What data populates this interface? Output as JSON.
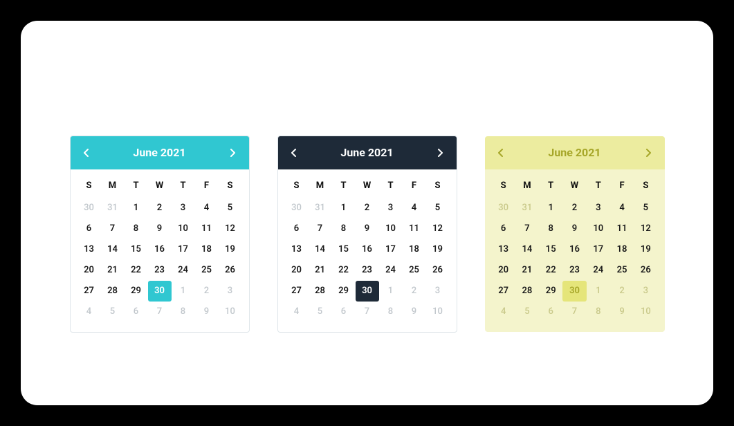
{
  "calendars": [
    {
      "theme": "teal",
      "title": "June 2021"
    },
    {
      "theme": "dark",
      "title": "June 2021"
    },
    {
      "theme": "olive",
      "title": "June 2021"
    }
  ],
  "dow": [
    "S",
    "M",
    "T",
    "W",
    "T",
    "F",
    "S"
  ],
  "grid": [
    [
      {
        "d": 30,
        "muted": true
      },
      {
        "d": 31,
        "muted": true
      },
      {
        "d": 1
      },
      {
        "d": 2
      },
      {
        "d": 3
      },
      {
        "d": 4
      },
      {
        "d": 5
      }
    ],
    [
      {
        "d": 6
      },
      {
        "d": 7
      },
      {
        "d": 8
      },
      {
        "d": 9
      },
      {
        "d": 10
      },
      {
        "d": 11
      },
      {
        "d": 12
      }
    ],
    [
      {
        "d": 13
      },
      {
        "d": 14
      },
      {
        "d": 15
      },
      {
        "d": 16
      },
      {
        "d": 17
      },
      {
        "d": 18
      },
      {
        "d": 19
      }
    ],
    [
      {
        "d": 20
      },
      {
        "d": 21
      },
      {
        "d": 22
      },
      {
        "d": 23
      },
      {
        "d": 24
      },
      {
        "d": 25
      },
      {
        "d": 26
      }
    ],
    [
      {
        "d": 27
      },
      {
        "d": 28
      },
      {
        "d": 29
      },
      {
        "d": 30,
        "sel": true
      },
      {
        "d": 1,
        "muted": true
      },
      {
        "d": 2,
        "muted": true
      },
      {
        "d": 3,
        "muted": true
      }
    ],
    [
      {
        "d": 4,
        "muted": true
      },
      {
        "d": 5,
        "muted": true
      },
      {
        "d": 6,
        "muted": true
      },
      {
        "d": 7,
        "muted": true
      },
      {
        "d": 8,
        "muted": true
      },
      {
        "d": 9,
        "muted": true
      },
      {
        "d": 10,
        "muted": true
      }
    ]
  ]
}
